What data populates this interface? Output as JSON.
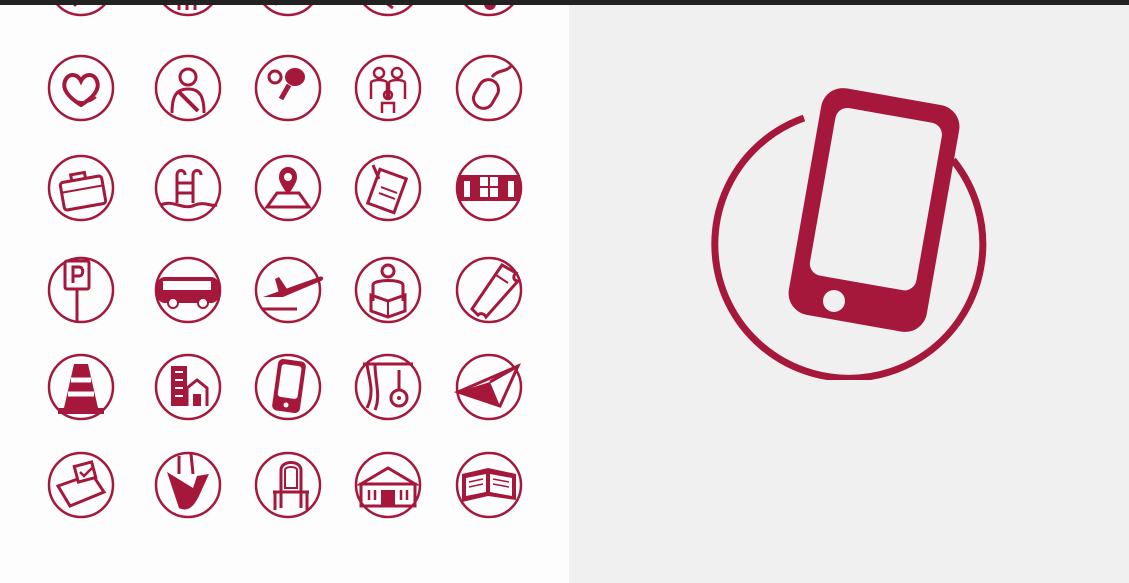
{
  "colors": {
    "accent": "#a5183b",
    "left_background": "#fdfdfd",
    "right_background": "#f0f0f0",
    "top_bar": "#222222"
  },
  "icon_grid": {
    "rows": [
      [
        "partial-icon",
        "partial-icon",
        "partial-icon",
        "partial-icon",
        "partial-icon"
      ],
      [
        "heart-icon",
        "person-seatbelt-icon",
        "table-tennis-icon",
        "family-icon",
        "computer-mouse-icon"
      ],
      [
        "briefcase-icon",
        "pool-ladder-icon",
        "map-pin-icon",
        "notepad-pencil-icon",
        "building-facade-icon"
      ],
      [
        "parking-sign-icon",
        "bus-icon",
        "airplane-icon",
        "person-reading-icon",
        "ticket-icon"
      ],
      [
        "traffic-cone-icon",
        "city-buildings-icon",
        "smartphone-icon",
        "theater-curtain-guitar-icon",
        "paper-plane-icon"
      ],
      [
        "ballot-box-icon",
        "drink-straw-icon",
        "armchair-icon",
        "town-hall-icon",
        "open-book-icon"
      ]
    ]
  },
  "featured_icon": "smartphone-icon"
}
